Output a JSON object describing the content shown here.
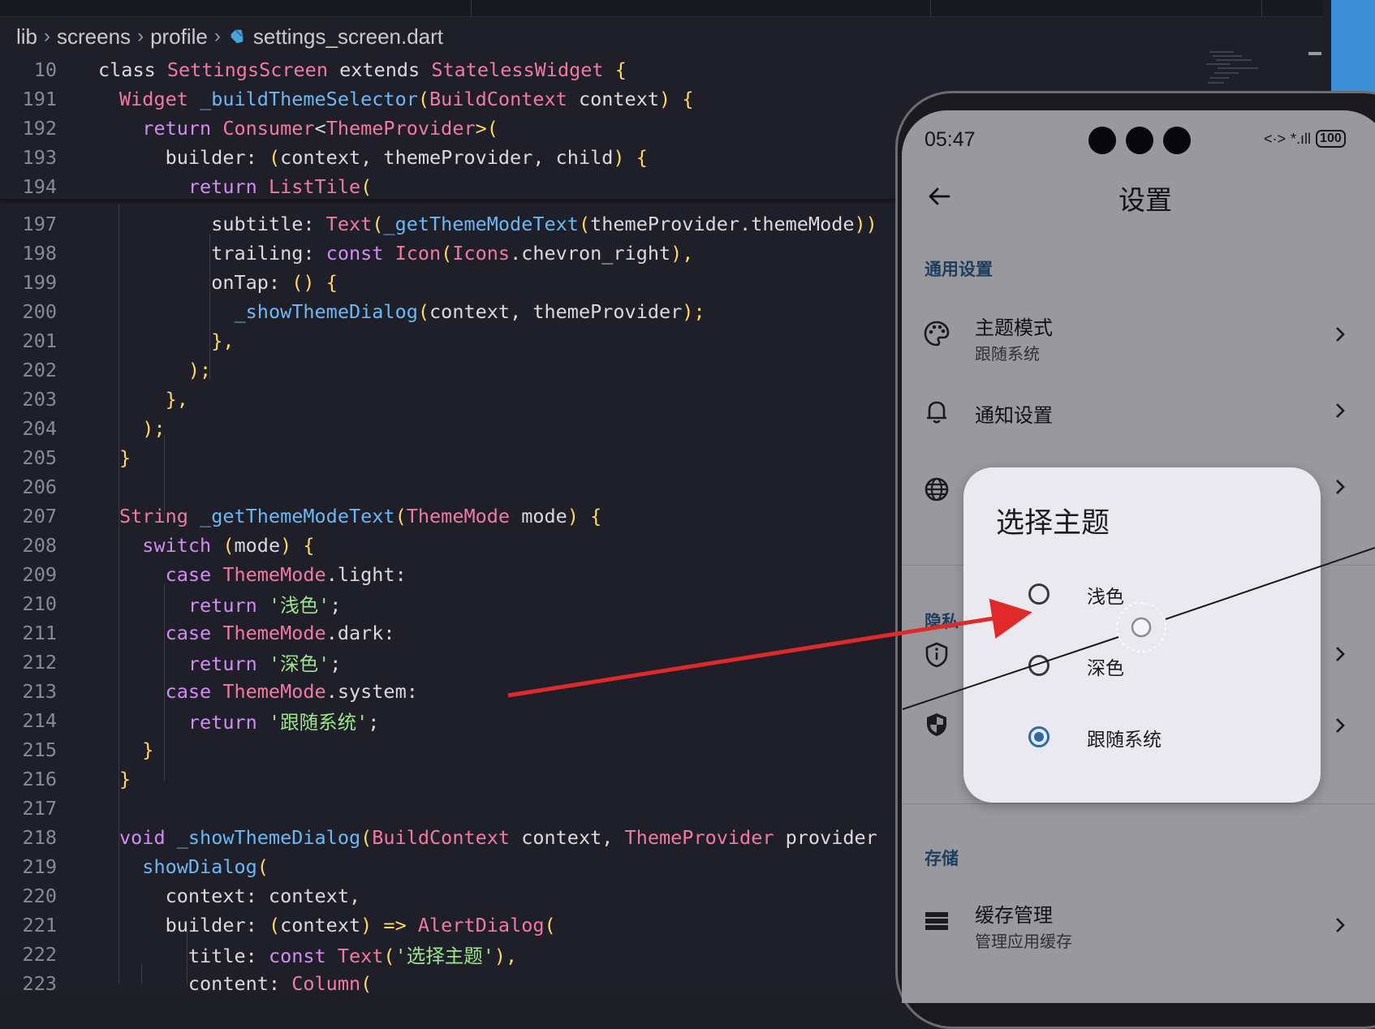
{
  "breadcrumb": {
    "items": [
      "lib",
      "screens",
      "profile",
      "settings_screen.dart"
    ]
  },
  "editor": {
    "lines": [
      {
        "n": "10",
        "indent": 0,
        "tokens": [
          [
            "class ",
            "pn"
          ],
          [
            "SettingsScreen ",
            "ty"
          ],
          [
            "extends ",
            "pn"
          ],
          [
            "StatelessWidget ",
            "ty"
          ],
          [
            "{",
            "br"
          ]
        ]
      },
      {
        "n": "191",
        "indent": 1,
        "tokens": [
          [
            "Widget ",
            "ty"
          ],
          [
            "_buildThemeSelector",
            "fn"
          ],
          [
            "(",
            "br"
          ],
          [
            "BuildContext ",
            "ty"
          ],
          [
            "context",
            "pn"
          ],
          [
            ") ",
            "br"
          ],
          [
            "{",
            "br"
          ]
        ]
      },
      {
        "n": "192",
        "indent": 2,
        "tokens": [
          [
            "return ",
            "kw"
          ],
          [
            "Consumer",
            "ty"
          ],
          [
            "<",
            "pn"
          ],
          [
            "ThemeProvider",
            "ty"
          ],
          [
            ">(",
            "br"
          ]
        ]
      },
      {
        "n": "193",
        "indent": 3,
        "tokens": [
          [
            "builder: ",
            "pn"
          ],
          [
            "(",
            "br"
          ],
          [
            "context, themeProvider, child",
            "pn"
          ],
          [
            ") ",
            "br"
          ],
          [
            "{",
            "br"
          ]
        ]
      },
      {
        "n": "194",
        "indent": 4,
        "tokens": [
          [
            "return ",
            "kw"
          ],
          [
            "ListTile",
            "ty"
          ],
          [
            "(",
            "br"
          ]
        ]
      },
      {
        "n": "197",
        "indent": 5,
        "tokens": [
          [
            "subtitle: ",
            "pn"
          ],
          [
            "Text",
            "ty"
          ],
          [
            "(",
            "br"
          ],
          [
            "_getThemeModeText",
            "fn"
          ],
          [
            "(",
            "br"
          ],
          [
            "themeProvider.themeMode",
            "pn"
          ],
          [
            "))",
            "br"
          ]
        ]
      },
      {
        "n": "198",
        "indent": 5,
        "tokens": [
          [
            "trailing: ",
            "pn"
          ],
          [
            "const ",
            "kw"
          ],
          [
            "Icon",
            "ty"
          ],
          [
            "(",
            "br"
          ],
          [
            "Icons",
            "ty"
          ],
          [
            ".chevron_right",
            "pn"
          ],
          [
            "),",
            "br"
          ]
        ]
      },
      {
        "n": "199",
        "indent": 5,
        "tokens": [
          [
            "onTap: ",
            "pn"
          ],
          [
            "() ",
            "br"
          ],
          [
            "{",
            "br"
          ]
        ]
      },
      {
        "n": "200",
        "indent": 6,
        "tokens": [
          [
            "_showThemeDialog",
            "fn"
          ],
          [
            "(",
            "br"
          ],
          [
            "context, themeProvider",
            "pn"
          ],
          [
            ");",
            "br"
          ]
        ]
      },
      {
        "n": "201",
        "indent": 5,
        "tokens": [
          [
            "},",
            "br"
          ]
        ]
      },
      {
        "n": "202",
        "indent": 4,
        "tokens": [
          [
            ");",
            "br"
          ]
        ]
      },
      {
        "n": "203",
        "indent": 3,
        "tokens": [
          [
            "},",
            "br"
          ]
        ]
      },
      {
        "n": "204",
        "indent": 2,
        "tokens": [
          [
            ");",
            "br"
          ]
        ]
      },
      {
        "n": "205",
        "indent": 1,
        "tokens": [
          [
            "}",
            "br"
          ]
        ]
      },
      {
        "n": "206",
        "indent": 0,
        "tokens": []
      },
      {
        "n": "207",
        "indent": 1,
        "tokens": [
          [
            "String ",
            "ty"
          ],
          [
            "_getThemeModeText",
            "fn"
          ],
          [
            "(",
            "br"
          ],
          [
            "ThemeMode ",
            "ty"
          ],
          [
            "mode",
            "pn"
          ],
          [
            ") ",
            "br"
          ],
          [
            "{",
            "br"
          ]
        ]
      },
      {
        "n": "208",
        "indent": 2,
        "tokens": [
          [
            "switch ",
            "kw"
          ],
          [
            "(",
            "br"
          ],
          [
            "mode",
            "pn"
          ],
          [
            ") ",
            "br"
          ],
          [
            "{",
            "br"
          ]
        ]
      },
      {
        "n": "209",
        "indent": 3,
        "tokens": [
          [
            "case ",
            "kw"
          ],
          [
            "ThemeMode",
            "ty"
          ],
          [
            ".light:",
            "pn"
          ]
        ]
      },
      {
        "n": "210",
        "indent": 4,
        "tokens": [
          [
            "return ",
            "kw"
          ],
          [
            "'浅色'",
            "st"
          ],
          [
            ";",
            "pn"
          ]
        ]
      },
      {
        "n": "211",
        "indent": 3,
        "tokens": [
          [
            "case ",
            "kw"
          ],
          [
            "ThemeMode",
            "ty"
          ],
          [
            ".dark:",
            "pn"
          ]
        ]
      },
      {
        "n": "212",
        "indent": 4,
        "tokens": [
          [
            "return ",
            "kw"
          ],
          [
            "'深色'",
            "st"
          ],
          [
            ";",
            "pn"
          ]
        ]
      },
      {
        "n": "213",
        "indent": 3,
        "tokens": [
          [
            "case ",
            "kw"
          ],
          [
            "ThemeMode",
            "ty"
          ],
          [
            ".system:",
            "pn"
          ]
        ]
      },
      {
        "n": "214",
        "indent": 4,
        "tokens": [
          [
            "return ",
            "kw"
          ],
          [
            "'跟随系统'",
            "st"
          ],
          [
            ";",
            "pn"
          ]
        ]
      },
      {
        "n": "215",
        "indent": 2,
        "tokens": [
          [
            "}",
            "br"
          ]
        ]
      },
      {
        "n": "216",
        "indent": 1,
        "tokens": [
          [
            "}",
            "br"
          ]
        ]
      },
      {
        "n": "217",
        "indent": 0,
        "tokens": []
      },
      {
        "n": "218",
        "indent": 1,
        "tokens": [
          [
            "void ",
            "kw"
          ],
          [
            "_showThemeDialog",
            "fn"
          ],
          [
            "(",
            "br"
          ],
          [
            "BuildContext ",
            "ty"
          ],
          [
            "context, ",
            "pn"
          ],
          [
            "ThemeProvider ",
            "ty"
          ],
          [
            "provider",
            "pn"
          ]
        ]
      },
      {
        "n": "219",
        "indent": 2,
        "tokens": [
          [
            "showDialog",
            "fn"
          ],
          [
            "(",
            "br"
          ]
        ]
      },
      {
        "n": "220",
        "indent": 3,
        "tokens": [
          [
            "context: context,",
            "pn"
          ]
        ]
      },
      {
        "n": "221",
        "indent": 3,
        "tokens": [
          [
            "builder: ",
            "pn"
          ],
          [
            "(",
            "br"
          ],
          [
            "context",
            "pn"
          ],
          [
            ") => ",
            "br"
          ],
          [
            "AlertDialog",
            "ty"
          ],
          [
            "(",
            "br"
          ]
        ]
      },
      {
        "n": "222",
        "indent": 4,
        "tokens": [
          [
            "title: ",
            "pn"
          ],
          [
            "const ",
            "kw"
          ],
          [
            "Text",
            "ty"
          ],
          [
            "(",
            "br"
          ],
          [
            "'选择主题'",
            "st"
          ],
          [
            "),",
            "br"
          ]
        ]
      },
      {
        "n": "223",
        "indent": 4,
        "tokens": [
          [
            "content: ",
            "pn"
          ],
          [
            "Column",
            "ty"
          ],
          [
            "(",
            "br"
          ]
        ]
      }
    ]
  },
  "phone": {
    "status": {
      "time": "05:47",
      "network": "<·>",
      "signal": "*.ıll",
      "battery": "100"
    },
    "app_title": "设置",
    "sections": {
      "general": "通用设置",
      "privacy": "隐私",
      "storage": "存储"
    },
    "rows": {
      "theme": {
        "title": "主题模式",
        "subtitle": "跟随系统"
      },
      "notifications": {
        "title": "通知设置"
      },
      "cache": {
        "title": "缓存管理",
        "subtitle": "管理应用缓存"
      }
    },
    "dialog": {
      "title": "选择主题",
      "options": [
        "浅色",
        "深色",
        "跟随系统"
      ],
      "selected": "跟随系统"
    }
  },
  "colors": {
    "accent": "#2d6aa8",
    "arrow": "#e0292a",
    "keyword": "#d38cf2",
    "type": "#f27aa0",
    "function": "#6cb8f5",
    "string": "#9ee68a"
  },
  "icons": [
    "dart-file-icon",
    "back-arrow-icon",
    "palette-icon",
    "bell-icon",
    "globe-icon",
    "privacy-shield-icon",
    "security-shield-icon",
    "storage-icon",
    "chevron-right-icon"
  ]
}
